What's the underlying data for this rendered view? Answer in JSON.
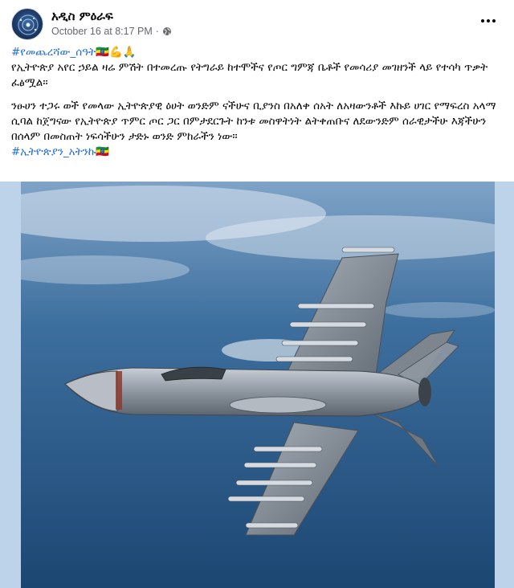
{
  "post": {
    "page_name": "አዲስ ምዕራፍ",
    "timestamp": "October 16 at 8:17 PM",
    "separator": "·",
    "hashtag_top": "#የመጨረሻው_ሰዓት🇪🇹💪🙏",
    "paragraph1": "የኢትዮጵያ አየር ኃይል ዛሬ ምሽት በተመረጡ የትግራይ ከተሞችና የጦር ግምጃ ቤቶች የመሳሪያ መገዘንች ላይ የተሳካ ጥቃት ፈፅሟል።",
    "paragraph2": "ንፁሀን ተጋሩ ወች የመላው ኢትዮጵያዊ ዕሀት ወንድም ናችሁና ቢያንስ በአለቀ ሰአት ለአዛውንቶች እኩይ ሀገር የማፍረስ አላማ ሲባል ከጀግናው የኢትዮጵያ ጥምር ጦር ጋር በምታደርጉት ከንቱ መስዋትነት ልትቀጠቡና ለደውንድም ሰራዊታችሁ እጃችሁን በሰላም በመስጠት ነፍሳችሁን ታድኑ ወንድ ምከራችን ነው።",
    "hashtag_bottom": "#ኢትዮጵያን_አትንኩ🇪🇹"
  },
  "icons": {
    "privacy": "globe-icon",
    "menu": "more-horizontal-icon"
  },
  "colors": {
    "hashtag": "#216fdb",
    "meta": "#65676b",
    "sky": "#bcd3ea"
  }
}
